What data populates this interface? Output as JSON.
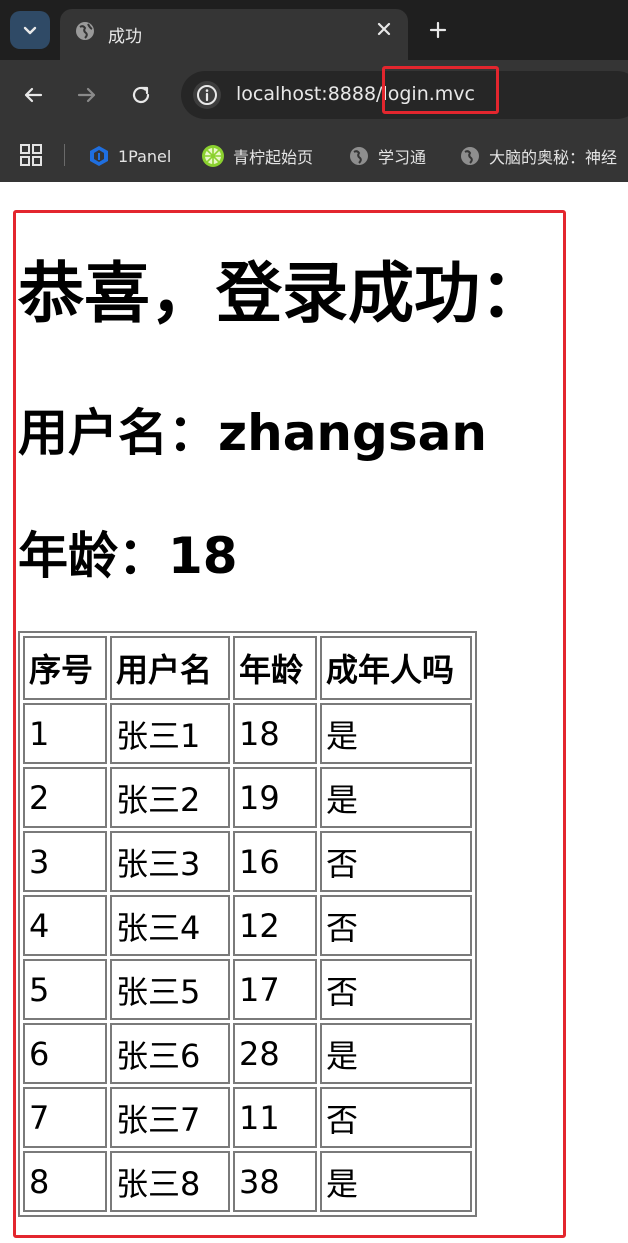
{
  "browser": {
    "tab": {
      "title": "成功"
    },
    "url": {
      "host": "localhost:8888",
      "path": "/login.mvc"
    },
    "bookmarks": [
      {
        "label": "1Panel",
        "icon": "1panel-icon"
      },
      {
        "label": "青柠起始页",
        "icon": "lime-icon"
      },
      {
        "label": "学习通",
        "icon": "globe-icon"
      },
      {
        "label": "大脑的奥秘：神经",
        "icon": "globe-icon"
      }
    ],
    "colors": {
      "highlight": "#e3262e",
      "chrome_dark": "#1f1f1f",
      "chrome": "#353535"
    }
  },
  "page": {
    "title": "恭喜，登录成功：",
    "username_line": "用户名：zhangsan",
    "age_line": "年龄：18",
    "table": {
      "headers": [
        "序号",
        "用户名",
        "年龄",
        "成年人吗"
      ],
      "rows": [
        [
          "1",
          "张三1",
          "18",
          "是"
        ],
        [
          "2",
          "张三2",
          "19",
          "是"
        ],
        [
          "3",
          "张三3",
          "16",
          "否"
        ],
        [
          "4",
          "张三4",
          "12",
          "否"
        ],
        [
          "5",
          "张三5",
          "17",
          "否"
        ],
        [
          "6",
          "张三6",
          "28",
          "是"
        ],
        [
          "7",
          "张三7",
          "11",
          "否"
        ],
        [
          "8",
          "张三8",
          "38",
          "是"
        ]
      ]
    }
  }
}
